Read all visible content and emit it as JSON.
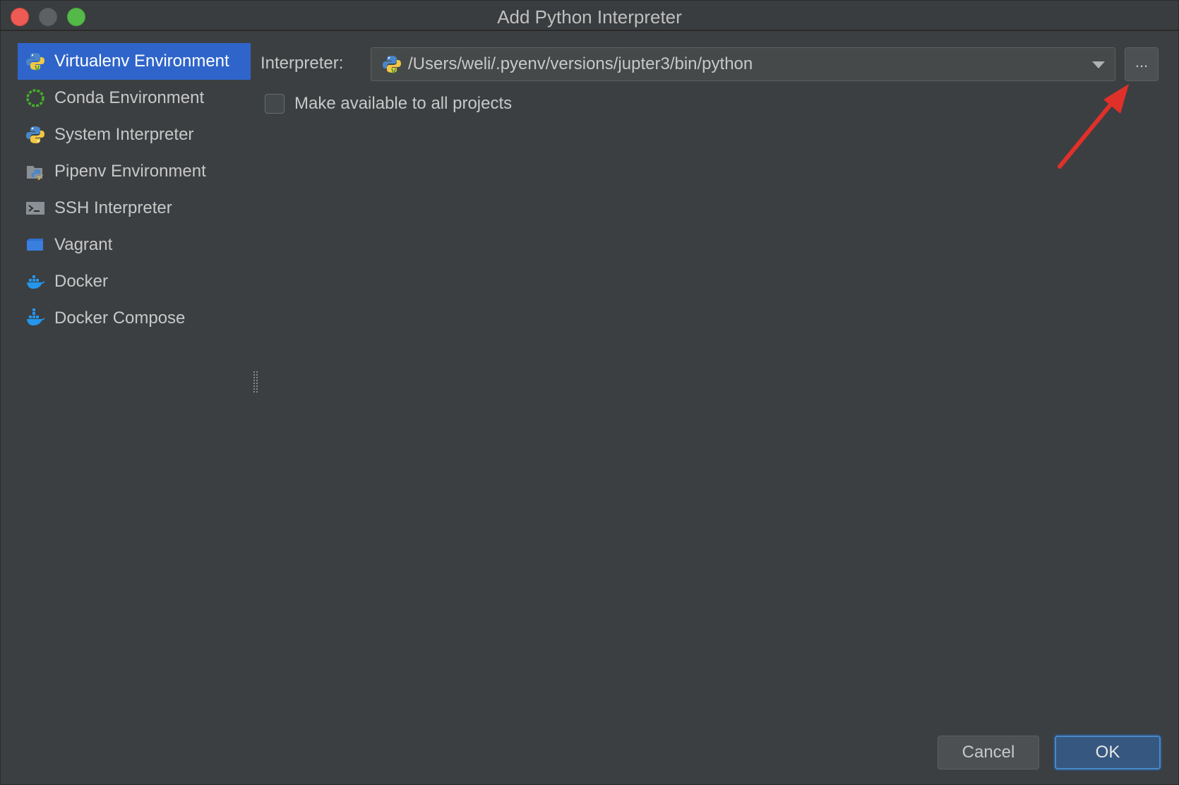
{
  "window": {
    "title": "Add Python Interpreter"
  },
  "sidebar": {
    "items": [
      {
        "label": "Virtualenv Environment",
        "icon": "virtualenv-icon",
        "selected": true
      },
      {
        "label": "Conda Environment",
        "icon": "conda-icon",
        "selected": false
      },
      {
        "label": "System Interpreter",
        "icon": "python-icon",
        "selected": false
      },
      {
        "label": "Pipenv Environment",
        "icon": "pipenv-icon",
        "selected": false
      },
      {
        "label": "SSH Interpreter",
        "icon": "terminal-icon",
        "selected": false
      },
      {
        "label": "Vagrant",
        "icon": "vagrant-icon",
        "selected": false
      },
      {
        "label": "Docker",
        "icon": "docker-icon",
        "selected": false
      },
      {
        "label": "Docker Compose",
        "icon": "docker-compose-icon",
        "selected": false
      }
    ]
  },
  "form": {
    "interpreter_label": "Interpreter:",
    "interpreter_value": "/Users/weli/.pyenv/versions/jupter3/bin/python",
    "browse_label": "...",
    "make_available_label": "Make available to all projects",
    "make_available_checked": false
  },
  "footer": {
    "cancel_label": "Cancel",
    "ok_label": "OK"
  },
  "colors": {
    "background": "#3c3f41",
    "selection": "#2f65ca",
    "annotation_arrow": "#e0302a",
    "ok_button": "#365880"
  }
}
